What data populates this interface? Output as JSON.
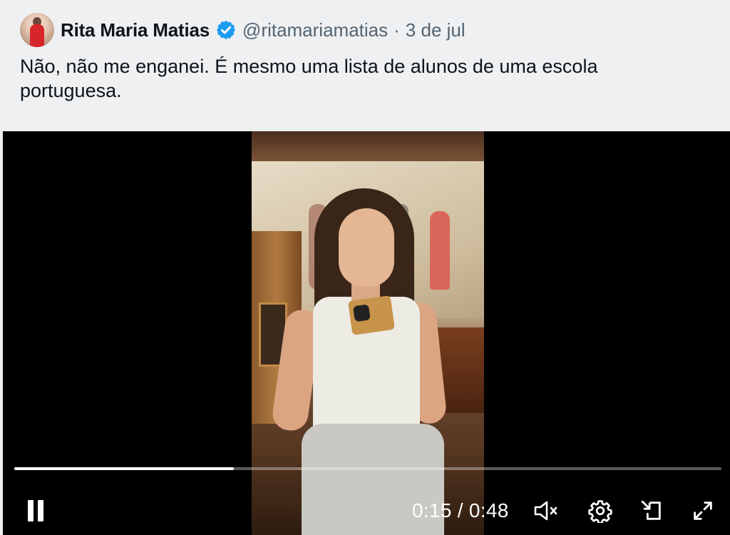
{
  "author": {
    "name": "Rita Maria Matias",
    "handle": "@ritamariamatias",
    "separator": "·",
    "date": "3 de jul",
    "verified": true
  },
  "tweet": {
    "text": "Não, não me enganei. É mesmo uma lista de alunos de uma escola portuguesa."
  },
  "video": {
    "state": "playing",
    "time_display": "0:15 / 0:48",
    "progress_fraction": 0.31,
    "icons": [
      "pause-icon",
      "mute-icon",
      "settings-icon",
      "dock-icon",
      "fullscreen-icon"
    ]
  },
  "colors": {
    "verified_badge": "#1d9bf0",
    "handle_text": "#536471",
    "background": "#eef0f2",
    "video_bg": "#000000"
  }
}
